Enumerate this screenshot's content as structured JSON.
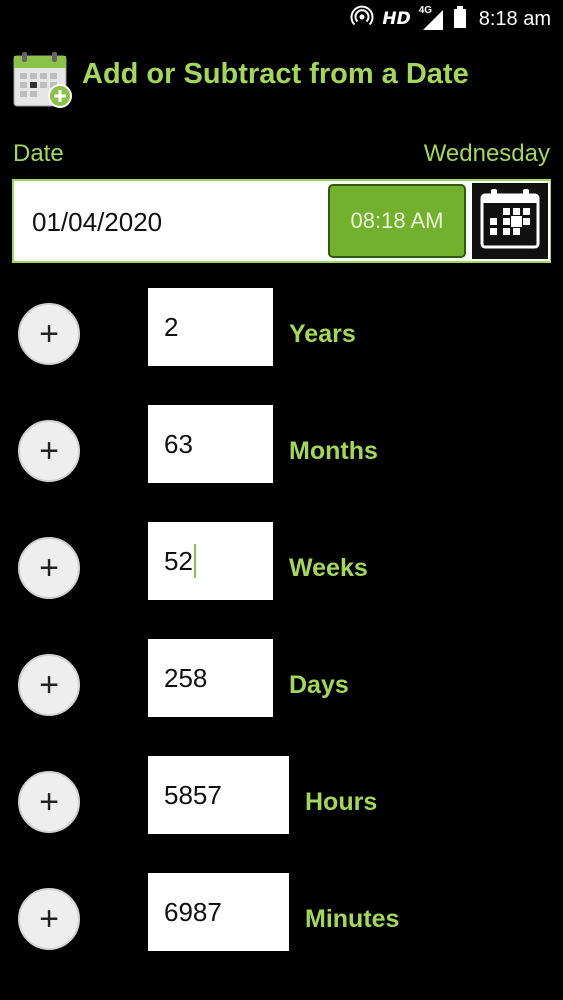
{
  "status_bar": {
    "hd_label": "HD",
    "network_label": "4G",
    "time": "8:18 am"
  },
  "header": {
    "title": "Add or Subtract from a Date",
    "icon": "calendar-add-icon"
  },
  "date_section": {
    "label": "Date",
    "weekday": "Wednesday",
    "date_value": "01/04/2020",
    "time_button_label": "08:18 AM",
    "calendar_icon": "calendar-icon"
  },
  "units": [
    {
      "operator": "+",
      "value": "2",
      "label": "Years"
    },
    {
      "operator": "+",
      "value": "63",
      "label": "Months"
    },
    {
      "operator": "+",
      "value": "52",
      "label": "Weeks"
    },
    {
      "operator": "+",
      "value": "258",
      "label": "Days"
    },
    {
      "operator": "+",
      "value": "5857",
      "label": "Hours"
    },
    {
      "operator": "+",
      "value": "6987",
      "label": "Minutes"
    }
  ],
  "colors": {
    "accent": "#a4d65e",
    "time_button": "#72b02e",
    "background": "#000000"
  }
}
